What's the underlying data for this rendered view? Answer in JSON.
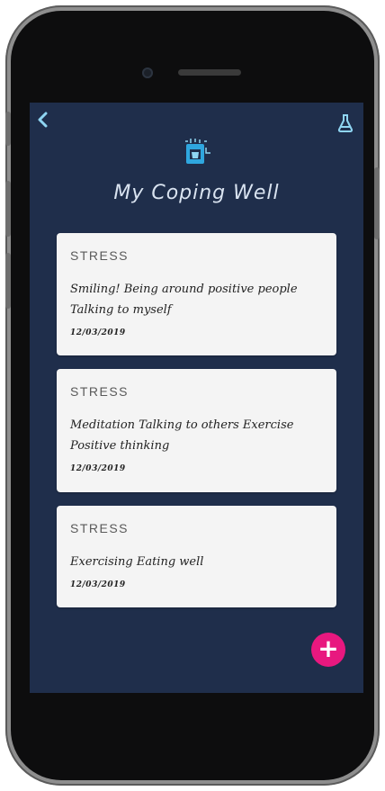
{
  "header": {
    "title": "My Coping Well"
  },
  "cards": [
    {
      "category": "STRESS",
      "entry": "Smiling! Being around positive people Talking to myself",
      "date": "12/03/2019"
    },
    {
      "category": "STRESS",
      "entry": "Meditation Talking to others Exercise Positive thinking",
      "date": "12/03/2019"
    },
    {
      "category": "STRESS",
      "entry": "Exercising Eating well",
      "date": "12/03/2019"
    }
  ],
  "fab": {
    "label": "+"
  },
  "icons": {
    "back": "back-chevron-icon",
    "flask": "flask-icon",
    "app": "coping-cup-icon",
    "add": "plus-icon"
  },
  "colors": {
    "screen_bg": "#1f2e4b",
    "card_bg": "#f4f4f4",
    "accent": "#e8187f",
    "icon_blue": "#8fd5f2"
  }
}
